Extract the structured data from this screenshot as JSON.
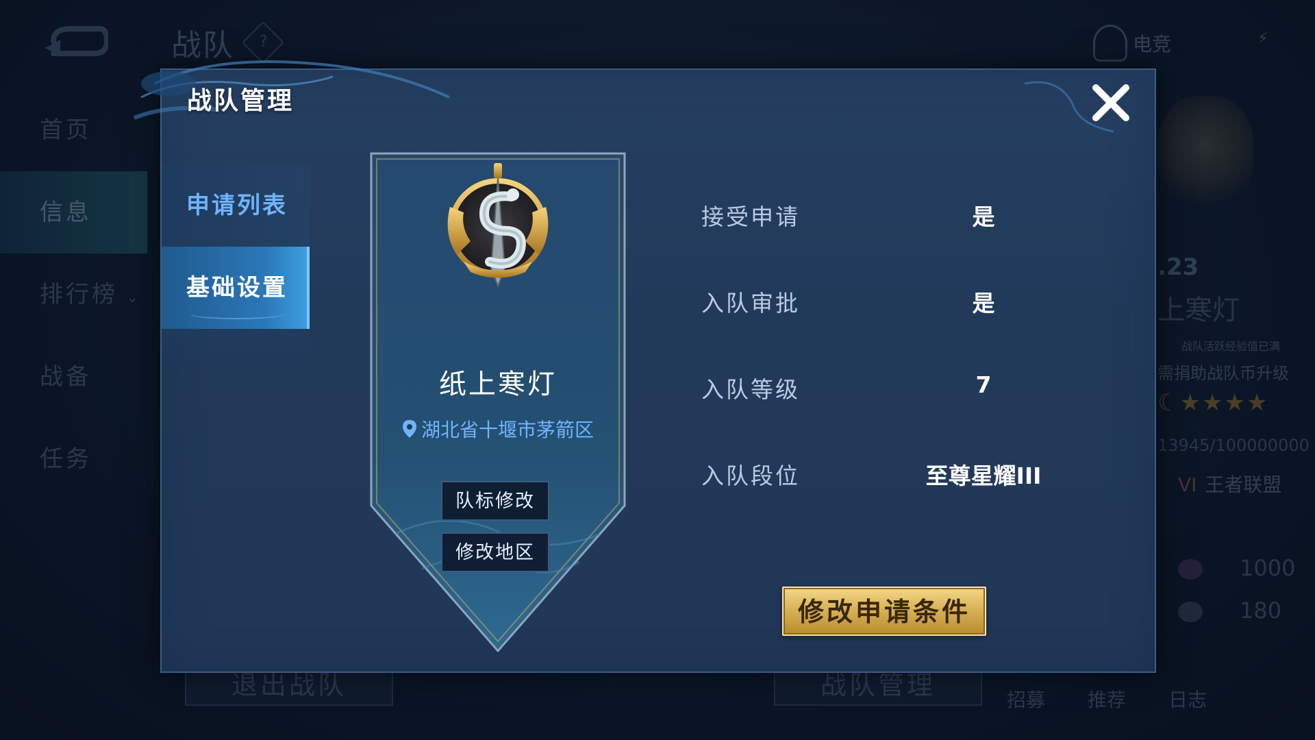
{
  "background": {
    "title": "战队",
    "help": "?",
    "esports": "电竞",
    "nav": [
      {
        "label": "首页"
      },
      {
        "label": "信息"
      },
      {
        "label": "排行榜"
      },
      {
        "label": "战备"
      },
      {
        "label": "任务"
      }
    ],
    "footer_left": "退出战队",
    "footer_right": "战队管理",
    "right_panel": {
      "number": ".23",
      "name": "上寒灯",
      "note1": "战队活跃经验值已满",
      "note2": "需捐助战队币升级",
      "stars": "★★★★",
      "progress_value": "13945",
      "progress_total": "/100000000",
      "league_badge": "VI",
      "league": "王者联盟",
      "currency1": "1000",
      "currency2": "180"
    },
    "bottom_tabs": [
      "招募",
      "推荐",
      "日志"
    ]
  },
  "modal": {
    "title": "战队管理",
    "tabs": [
      {
        "label": "申请列表",
        "active": false
      },
      {
        "label": "基础设置",
        "active": true
      }
    ],
    "team": {
      "name": "纸上寒灯",
      "location": "湖北省十堰市茅箭区",
      "change_logo": "队标修改",
      "change_region": "修改地区"
    },
    "settings": [
      {
        "label": "接受申请",
        "value": "是"
      },
      {
        "label": "入队审批",
        "value": "是"
      },
      {
        "label": "入队等级",
        "value": "7"
      },
      {
        "label": "入队段位",
        "value": "至尊星耀III"
      }
    ],
    "modify_button": "修改申请条件"
  },
  "colors": {
    "accent_blue": "#6fb4ff",
    "gold": "#d9b356",
    "panel": "#233c5c"
  }
}
